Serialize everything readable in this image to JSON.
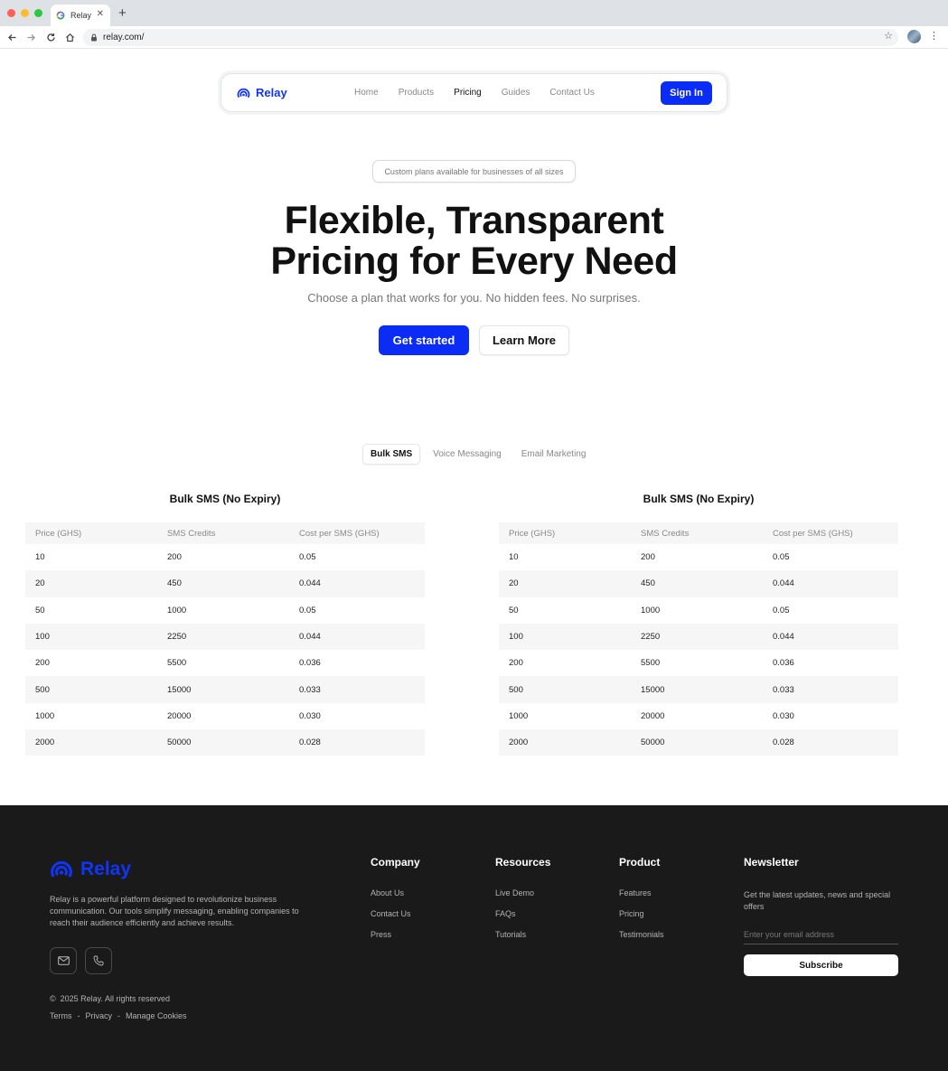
{
  "browser": {
    "tab_title": "Relay",
    "url": "relay.com/",
    "traffic_lights": [
      "#ff5f57",
      "#febc2e",
      "#28c840"
    ]
  },
  "nav": {
    "brand": "Relay",
    "links": [
      "Home",
      "Products",
      "Pricing",
      "Guides",
      "Contact Us"
    ],
    "active_link": "Pricing",
    "signin_label": "Sign In"
  },
  "hero": {
    "pill": "Custom plans available for businesses of all sizes",
    "title_line1": "Flexible, Transparent",
    "title_line2": "Pricing for Every Need",
    "subtitle": "Choose a plan that works for you. No hidden fees. No surprises.",
    "primary_cta": "Get started",
    "secondary_cta": "Learn More"
  },
  "pricing_tabs": [
    "Bulk SMS",
    "Voice Messaging",
    "Email Marketing"
  ],
  "active_pricing_tab": "Bulk SMS",
  "tables": [
    {
      "title": "Bulk SMS (No Expiry)",
      "headers": [
        "Price (GHS)",
        "SMS Credits",
        "Cost per SMS (GHS)"
      ],
      "rows": [
        [
          "10",
          "200",
          "0.05"
        ],
        [
          "20",
          "450",
          "0.044"
        ],
        [
          "50",
          "1000",
          "0.05"
        ],
        [
          "100",
          "2250",
          "0.044"
        ],
        [
          "200",
          "5500",
          "0.036"
        ],
        [
          "500",
          "15000",
          "0.033"
        ],
        [
          "1000",
          "20000",
          "0.030"
        ],
        [
          "2000",
          "50000",
          "0.028"
        ]
      ]
    },
    {
      "title": "Bulk SMS (No Expiry)",
      "headers": [
        "Price (GHS)",
        "SMS Credits",
        "Cost per SMS (GHS)"
      ],
      "rows": [
        [
          "10",
          "200",
          "0.05"
        ],
        [
          "20",
          "450",
          "0.044"
        ],
        [
          "50",
          "1000",
          "0.05"
        ],
        [
          "100",
          "2250",
          "0.044"
        ],
        [
          "200",
          "5500",
          "0.036"
        ],
        [
          "500",
          "15000",
          "0.033"
        ],
        [
          "1000",
          "20000",
          "0.030"
        ],
        [
          "2000",
          "50000",
          "0.028"
        ]
      ]
    }
  ],
  "footer": {
    "brand": "Relay",
    "description": "Relay is a powerful platform designed to revolutionize business communication. Our tools simplify messaging, enabling companies to reach their audience efficiently and achieve results.",
    "copyright": "2025 Relay. All rights reserved",
    "legal": [
      "Terms",
      "Privacy",
      "Manage Cookies"
    ],
    "columns": [
      {
        "title": "Company",
        "links": [
          "About Us",
          "Contact Us",
          "Press"
        ]
      },
      {
        "title": "Resources",
        "links": [
          "Live Demo",
          "FAQs",
          "Tutorials"
        ]
      },
      {
        "title": "Product",
        "links": [
          "Features",
          "Pricing",
          "Testimonials"
        ]
      }
    ],
    "newsletter": {
      "title": "Newsletter",
      "text": "Get the latest updates, news and special offers",
      "placeholder": "Enter your email address",
      "button": "Subscribe"
    }
  },
  "colors": {
    "brand_blue": "#0b2cf5",
    "footer_bg": "#1a1a1a"
  }
}
